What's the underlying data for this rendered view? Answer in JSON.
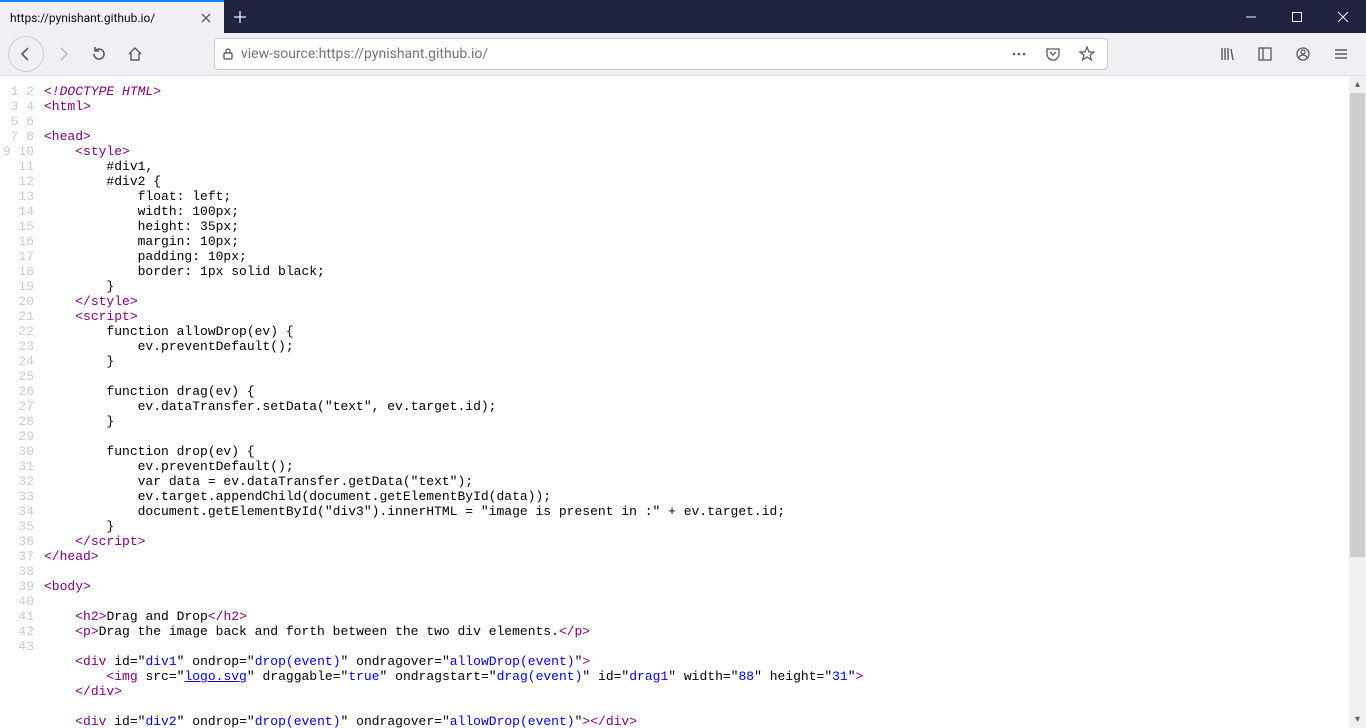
{
  "window": {
    "tab_title": "https://pynishant.github.io/",
    "url_display": "view-source:https://pynishant.github.io/"
  },
  "source": {
    "lines": [
      {
        "n": 1,
        "segs": [
          {
            "c": "t-pi",
            "t": "<!DOCTYPE HTML>"
          }
        ]
      },
      {
        "n": 2,
        "segs": [
          {
            "c": "t-tag",
            "t": "<html>"
          }
        ]
      },
      {
        "n": 3,
        "segs": []
      },
      {
        "n": 4,
        "segs": [
          {
            "c": "t-tag",
            "t": "<head>"
          }
        ]
      },
      {
        "n": 5,
        "segs": [
          {
            "c": "t-txt",
            "t": "    "
          },
          {
            "c": "t-tag",
            "t": "<style>"
          }
        ]
      },
      {
        "n": 6,
        "segs": [
          {
            "c": "t-txt",
            "t": "        #div1,"
          }
        ]
      },
      {
        "n": 7,
        "segs": [
          {
            "c": "t-txt",
            "t": "        #div2 {"
          }
        ]
      },
      {
        "n": 8,
        "segs": [
          {
            "c": "t-txt",
            "t": "            float: left;"
          }
        ]
      },
      {
        "n": 9,
        "segs": [
          {
            "c": "t-txt",
            "t": "            width: 100px;"
          }
        ]
      },
      {
        "n": 10,
        "segs": [
          {
            "c": "t-txt",
            "t": "            height: 35px;"
          }
        ]
      },
      {
        "n": 11,
        "segs": [
          {
            "c": "t-txt",
            "t": "            margin: 10px;"
          }
        ]
      },
      {
        "n": 12,
        "segs": [
          {
            "c": "t-txt",
            "t": "            padding: 10px;"
          }
        ]
      },
      {
        "n": 13,
        "segs": [
          {
            "c": "t-txt",
            "t": "            border: 1px solid black;"
          }
        ]
      },
      {
        "n": 14,
        "segs": [
          {
            "c": "t-txt",
            "t": "        }"
          }
        ]
      },
      {
        "n": 15,
        "segs": [
          {
            "c": "t-txt",
            "t": "    "
          },
          {
            "c": "t-tag",
            "t": "</style>"
          }
        ]
      },
      {
        "n": 16,
        "segs": [
          {
            "c": "t-txt",
            "t": "    "
          },
          {
            "c": "t-tag",
            "t": "<script>"
          }
        ]
      },
      {
        "n": 17,
        "segs": [
          {
            "c": "t-txt",
            "t": "        function allowDrop(ev) {"
          }
        ]
      },
      {
        "n": 18,
        "segs": [
          {
            "c": "t-txt",
            "t": "            ev.preventDefault();"
          }
        ]
      },
      {
        "n": 19,
        "segs": [
          {
            "c": "t-txt",
            "t": "        }"
          }
        ]
      },
      {
        "n": 20,
        "segs": []
      },
      {
        "n": 21,
        "segs": [
          {
            "c": "t-txt",
            "t": "        function drag(ev) {"
          }
        ]
      },
      {
        "n": 22,
        "segs": [
          {
            "c": "t-txt",
            "t": "            ev.dataTransfer.setData(\"text\", ev.target.id);"
          }
        ]
      },
      {
        "n": 23,
        "segs": [
          {
            "c": "t-txt",
            "t": "        }"
          }
        ]
      },
      {
        "n": 24,
        "segs": []
      },
      {
        "n": 25,
        "segs": [
          {
            "c": "t-txt",
            "t": "        function drop(ev) {"
          }
        ]
      },
      {
        "n": 26,
        "segs": [
          {
            "c": "t-txt",
            "t": "            ev.preventDefault();"
          }
        ]
      },
      {
        "n": 27,
        "segs": [
          {
            "c": "t-txt",
            "t": "            var data = ev.dataTransfer.getData(\"text\");"
          }
        ]
      },
      {
        "n": 28,
        "segs": [
          {
            "c": "t-txt",
            "t": "            ev.target.appendChild(document.getElementById(data));"
          }
        ]
      },
      {
        "n": 29,
        "segs": [
          {
            "c": "t-txt",
            "t": "            document.getElementById(\"div3\").innerHTML = \"image is present in :\" + ev.target.id;"
          }
        ]
      },
      {
        "n": 30,
        "segs": [
          {
            "c": "t-txt",
            "t": "        }"
          }
        ]
      },
      {
        "n": 31,
        "segs": [
          {
            "c": "t-txt",
            "t": "    "
          },
          {
            "c": "t-tag",
            "t": "</script>"
          }
        ]
      },
      {
        "n": 32,
        "segs": [
          {
            "c": "t-tag",
            "t": "</head>"
          }
        ]
      },
      {
        "n": 33,
        "segs": []
      },
      {
        "n": 34,
        "segs": [
          {
            "c": "t-tag",
            "t": "<body>"
          }
        ]
      },
      {
        "n": 35,
        "segs": []
      },
      {
        "n": 36,
        "segs": [
          {
            "c": "t-txt",
            "t": "    "
          },
          {
            "c": "t-tag",
            "t": "<h2>"
          },
          {
            "c": "t-txt",
            "t": "Drag and Drop"
          },
          {
            "c": "t-tag",
            "t": "</h2>"
          }
        ]
      },
      {
        "n": 37,
        "segs": [
          {
            "c": "t-txt",
            "t": "    "
          },
          {
            "c": "t-tag",
            "t": "<p>"
          },
          {
            "c": "t-txt",
            "t": "Drag the image back and forth between the two div elements."
          },
          {
            "c": "t-tag",
            "t": "</p>"
          }
        ]
      },
      {
        "n": 38,
        "segs": []
      },
      {
        "n": 39,
        "segs": [
          {
            "c": "t-txt",
            "t": "    "
          },
          {
            "c": "t-tag",
            "t": "<div "
          },
          {
            "c": "t-attr",
            "t": "id"
          },
          {
            "c": "t-txt",
            "t": "=\""
          },
          {
            "c": "t-val",
            "t": "div1"
          },
          {
            "c": "t-txt",
            "t": "\" "
          },
          {
            "c": "t-attr",
            "t": "ondrop"
          },
          {
            "c": "t-txt",
            "t": "=\""
          },
          {
            "c": "t-val",
            "t": "drop(event)"
          },
          {
            "c": "t-txt",
            "t": "\" "
          },
          {
            "c": "t-attr",
            "t": "ondragover"
          },
          {
            "c": "t-txt",
            "t": "=\""
          },
          {
            "c": "t-val",
            "t": "allowDrop(event)"
          },
          {
            "c": "t-txt",
            "t": "\""
          },
          {
            "c": "t-tag",
            "t": ">"
          }
        ]
      },
      {
        "n": 40,
        "segs": [
          {
            "c": "t-txt",
            "t": "        "
          },
          {
            "c": "t-tag",
            "t": "<img "
          },
          {
            "c": "t-attr",
            "t": "src"
          },
          {
            "c": "t-txt",
            "t": "=\""
          },
          {
            "c": "t-link",
            "t": "logo.svg"
          },
          {
            "c": "t-txt",
            "t": "\" "
          },
          {
            "c": "t-attr",
            "t": "draggable"
          },
          {
            "c": "t-txt",
            "t": "=\""
          },
          {
            "c": "t-val",
            "t": "true"
          },
          {
            "c": "t-txt",
            "t": "\" "
          },
          {
            "c": "t-attr",
            "t": "ondragstart"
          },
          {
            "c": "t-txt",
            "t": "=\""
          },
          {
            "c": "t-val",
            "t": "drag(event)"
          },
          {
            "c": "t-txt",
            "t": "\" "
          },
          {
            "c": "t-attr",
            "t": "id"
          },
          {
            "c": "t-txt",
            "t": "=\""
          },
          {
            "c": "t-val",
            "t": "drag1"
          },
          {
            "c": "t-txt",
            "t": "\" "
          },
          {
            "c": "t-attr",
            "t": "width"
          },
          {
            "c": "t-txt",
            "t": "=\""
          },
          {
            "c": "t-val",
            "t": "88"
          },
          {
            "c": "t-txt",
            "t": "\" "
          },
          {
            "c": "t-attr",
            "t": "height"
          },
          {
            "c": "t-txt",
            "t": "=\""
          },
          {
            "c": "t-val",
            "t": "31"
          },
          {
            "c": "t-txt",
            "t": "\""
          },
          {
            "c": "t-tag",
            "t": ">"
          }
        ]
      },
      {
        "n": 41,
        "segs": [
          {
            "c": "t-txt",
            "t": "    "
          },
          {
            "c": "t-tag",
            "t": "</div>"
          }
        ]
      },
      {
        "n": 42,
        "segs": []
      },
      {
        "n": 43,
        "segs": [
          {
            "c": "t-txt",
            "t": "    "
          },
          {
            "c": "t-tag",
            "t": "<div "
          },
          {
            "c": "t-attr",
            "t": "id"
          },
          {
            "c": "t-txt",
            "t": "=\""
          },
          {
            "c": "t-val",
            "t": "div2"
          },
          {
            "c": "t-txt",
            "t": "\" "
          },
          {
            "c": "t-attr",
            "t": "ondrop"
          },
          {
            "c": "t-txt",
            "t": "=\""
          },
          {
            "c": "t-val",
            "t": "drop(event)"
          },
          {
            "c": "t-txt",
            "t": "\" "
          },
          {
            "c": "t-attr",
            "t": "ondragover"
          },
          {
            "c": "t-txt",
            "t": "=\""
          },
          {
            "c": "t-val",
            "t": "allowDrop(event)"
          },
          {
            "c": "t-txt",
            "t": "\""
          },
          {
            "c": "t-tag",
            "t": ">"
          },
          {
            "c": "t-tag",
            "t": "</div>"
          }
        ]
      }
    ]
  }
}
